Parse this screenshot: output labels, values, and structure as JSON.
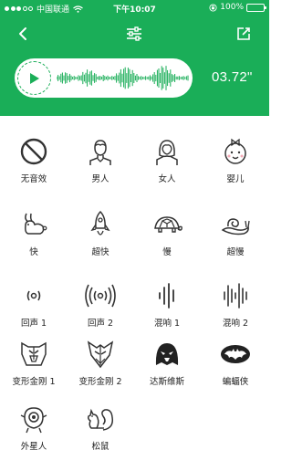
{
  "status_bar": {
    "carrier": "中国联通",
    "time": "下午10:07",
    "battery": "100%"
  },
  "nav": {
    "back_icon": "back-arrow-icon",
    "settings_icon": "sliders-icon",
    "share_icon": "share-icon"
  },
  "player": {
    "duration": "03.72\"",
    "play_icon": "play-icon"
  },
  "colors": {
    "accent": "#1aae58",
    "icon": "#333333"
  },
  "effects": [
    {
      "label": "无音效",
      "icon": "no-effect-icon"
    },
    {
      "label": "男人",
      "icon": "man-icon"
    },
    {
      "label": "女人",
      "icon": "woman-icon"
    },
    {
      "label": "婴儿",
      "icon": "baby-icon"
    },
    {
      "label": "快",
      "icon": "rabbit-icon"
    },
    {
      "label": "超快",
      "icon": "rocket-icon"
    },
    {
      "label": "慢",
      "icon": "turtle-icon"
    },
    {
      "label": "超慢",
      "icon": "snail-icon"
    },
    {
      "label": "回声 1",
      "icon": "echo-1-icon"
    },
    {
      "label": "回声 2",
      "icon": "echo-2-icon"
    },
    {
      "label": "混响 1",
      "icon": "reverb-1-icon"
    },
    {
      "label": "混响 2",
      "icon": "reverb-2-icon"
    },
    {
      "label": "变形金刚 1",
      "icon": "autobot-icon"
    },
    {
      "label": "变形金刚 2",
      "icon": "decepticon-icon"
    },
    {
      "label": "达斯维斯",
      "icon": "darth-vader-icon"
    },
    {
      "label": "蝙蝠侠",
      "icon": "batman-icon"
    },
    {
      "label": "外星人",
      "icon": "alien-icon"
    },
    {
      "label": "松鼠",
      "icon": "squirrel-icon"
    }
  ]
}
